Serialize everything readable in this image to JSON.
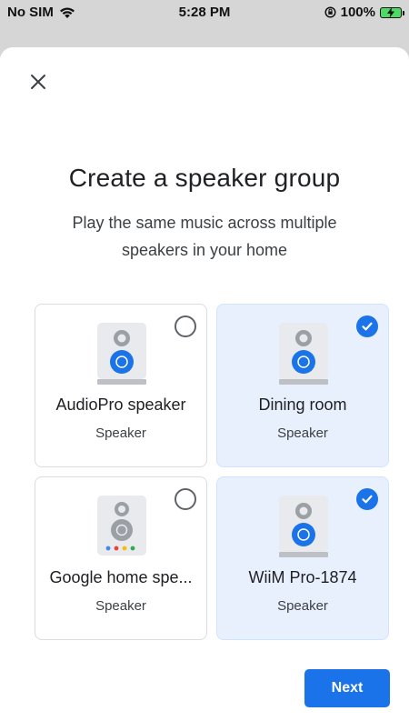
{
  "status_bar": {
    "carrier": "No SIM",
    "time": "5:28 PM",
    "battery": "100%",
    "icons": [
      "wifi-icon",
      "orientation-lock-icon",
      "battery-charging-icon"
    ]
  },
  "header": {
    "close_icon": "close-icon"
  },
  "main": {
    "title": "Create a speaker group",
    "subtitle": "Play the same music across multiple speakers in your home"
  },
  "speakers": [
    {
      "name": "AudioPro speaker",
      "type": "Speaker",
      "selected": false,
      "icon": "speaker-icon"
    },
    {
      "name": "Dining room",
      "type": "Speaker",
      "selected": true,
      "icon": "speaker-icon"
    },
    {
      "name": "Google home spe...",
      "type": "Speaker",
      "selected": false,
      "icon": "google-home-speaker-icon"
    },
    {
      "name": "WiiM Pro-1874",
      "type": "Speaker",
      "selected": true,
      "icon": "speaker-icon"
    }
  ],
  "footer": {
    "next_label": "Next"
  },
  "colors": {
    "accent": "#1a73e8",
    "selected_card_bg": "#e8f0fe",
    "card_border": "#dadce0",
    "overlay_bg": "#d6d6d6"
  }
}
